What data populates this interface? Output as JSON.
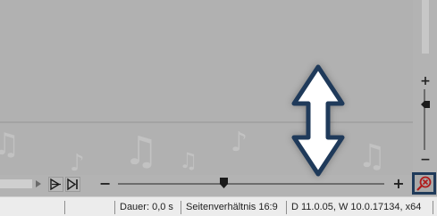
{
  "timeline": {
    "note_glyph": "♫",
    "note_glyph_single": "♪"
  },
  "zoom": {
    "minus_label": "−",
    "plus_label": "+"
  },
  "vertical_zoom": {
    "plus_label": "+",
    "minus_label": "−"
  },
  "status": {
    "duration": "Dauer: 0,0 s",
    "aspect_ratio": "Seitenverhältnis 16:9",
    "version": "D 11.0.05, W 10.0.17134, x64"
  },
  "colors": {
    "arrow_fill": "#ffffff",
    "arrow_stroke": "#1f3a5a",
    "accent": "#1f3a5a",
    "zoom_icon": "#b01a1a"
  },
  "icons": {
    "big_arrow": "double-vertical-arrow-icon",
    "zoom_fit": "zoom-fit-icon",
    "play_marker": "play-marker-icon",
    "skip_end": "skip-to-end-icon"
  }
}
